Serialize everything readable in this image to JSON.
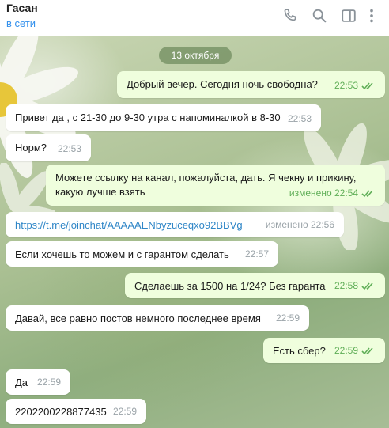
{
  "header": {
    "name": "Гасан",
    "status": "в сети"
  },
  "date_label": "13 октября",
  "messages": [
    {
      "text": "Добрый вечер. Сегодня ночь свободна?",
      "time": "22:53"
    },
    {
      "text": "Привет да , с 21-30 до 9-30 утра с напоминалкой в 8-30",
      "time": "22:53"
    },
    {
      "text": "Норм?",
      "time": "22:53"
    },
    {
      "line1": "Можете ссылку на канал, пожалуйста, дать. Я чекну и прикину,",
      "line2": "какую лучше взять",
      "time": "изменено 22:54"
    },
    {
      "text": "https://t.me/joinchat/AAAAAENbyzuceqxo92BBVg",
      "time": "изменено 22:56"
    },
    {
      "text": "Если хочешь то можем и с гарантом сделать",
      "time": "22:57"
    },
    {
      "text": "Сделаешь за 1500 на 1/24? Без гаранта",
      "time": "22:58"
    },
    {
      "text": "Давай, все равно постов немного последнее время",
      "time": "22:59"
    },
    {
      "text": "Есть сбер?",
      "time": "22:59"
    },
    {
      "text": "Да",
      "time": "22:59"
    },
    {
      "text": "2202200228877435",
      "time": "22:59"
    }
  ]
}
